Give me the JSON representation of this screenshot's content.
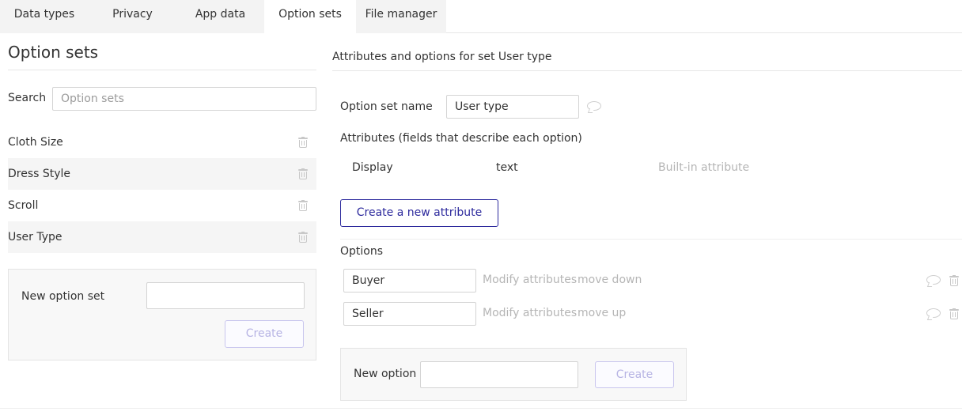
{
  "tabs": [
    {
      "label": "Data types"
    },
    {
      "label": "Privacy"
    },
    {
      "label": "App data"
    },
    {
      "label": "Option sets",
      "active": true
    },
    {
      "label": "File manager"
    }
  ],
  "left": {
    "title": "Option sets",
    "search_label": "Search",
    "search_placeholder": "Option sets",
    "option_sets": [
      {
        "label": "Cloth Size"
      },
      {
        "label": "Dress Style"
      },
      {
        "label": "Scroll"
      },
      {
        "label": "User Type"
      }
    ],
    "new_set_label": "New option set",
    "create_label": "Create"
  },
  "right": {
    "title": "Attributes and options for set User type",
    "name_label": "Option set name",
    "name_value": "User type",
    "attributes_heading": "Attributes (fields that describe each option)",
    "attribute": {
      "name": "Display",
      "type": "text",
      "note": "Built-in attribute"
    },
    "create_attribute_label": "Create a new attribute",
    "options_heading": "Options",
    "options": [
      {
        "value": "Buyer",
        "modify": "Modify attributes",
        "move": "move down"
      },
      {
        "value": "Seller",
        "modify": "Modify attributes",
        "move": "move up"
      }
    ],
    "new_option_label": "New option",
    "create_label": "Create"
  },
  "colors": {
    "accent": "#2d2a9d",
    "muted": "#b5b5b5",
    "disabled_border": "#c9c6ee"
  },
  "icons": {
    "delete": "trash-icon",
    "comment": "comment-icon"
  }
}
